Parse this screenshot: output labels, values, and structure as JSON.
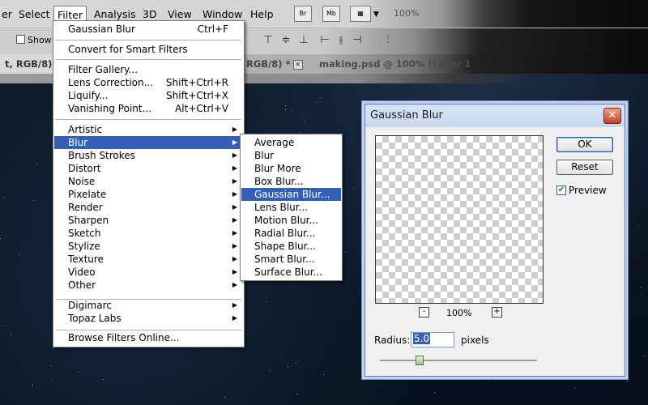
{
  "menubar": {
    "items": [
      {
        "label": "er"
      },
      {
        "label": "Select"
      },
      {
        "label": "Filter"
      },
      {
        "label": "Analysis"
      },
      {
        "label": "3D"
      },
      {
        "label": "View"
      },
      {
        "label": "Window"
      },
      {
        "label": "Help"
      }
    ],
    "bridge_label": "Br",
    "minibridge_label": "Mb",
    "zoom": "100%"
  },
  "options": {
    "show_transform": "Show T"
  },
  "tabs": {
    "active": "t, RGB/8)",
    "second": "RGB/8) *",
    "third": "making.psd @ 100% (Layer 1"
  },
  "filter_menu": {
    "last_filter": {
      "label": "Gaussian Blur",
      "shortcut": "Ctrl+F"
    },
    "convert": "Convert for Smart Filters",
    "gallery": "Filter Gallery...",
    "lens_correction": {
      "label": "Lens Correction...",
      "shortcut": "Shift+Ctrl+R"
    },
    "liquify": {
      "label": "Liquify...",
      "shortcut": "Shift+Ctrl+X"
    },
    "vanishing": {
      "label": "Vanishing Point...",
      "shortcut": "Alt+Ctrl+V"
    },
    "groups": [
      "Artistic",
      "Blur",
      "Brush Strokes",
      "Distort",
      "Noise",
      "Pixelate",
      "Render",
      "Sharpen",
      "Sketch",
      "Stylize",
      "Texture",
      "Video",
      "Other"
    ],
    "plugins": [
      "Digimarc",
      "Topaz Labs"
    ],
    "browse": "Browse Filters Online..."
  },
  "blur_submenu": {
    "items": [
      "Average",
      "Blur",
      "Blur More",
      "Box Blur...",
      "Gaussian Blur...",
      "Lens Blur...",
      "Motion Blur...",
      "Radial Blur...",
      "Shape Blur...",
      "Smart Blur...",
      "Surface Blur..."
    ]
  },
  "dialog": {
    "title": "Gaussian Blur",
    "close": "✕",
    "ok": "OK",
    "reset": "Reset",
    "preview_label": "Preview",
    "preview_checked": "✔",
    "zoom_out": "-",
    "zoom_in": "+",
    "zoom": "100%",
    "radius_label": "Radius:",
    "radius_value": "5.0",
    "radius_unit": "pixels",
    "radius_slider_fraction": 0.25
  }
}
